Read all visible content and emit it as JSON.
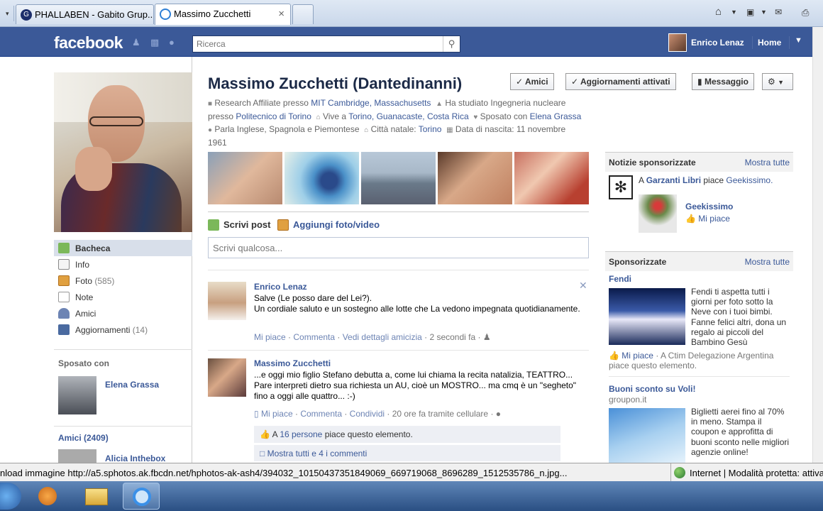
{
  "browser": {
    "tabs": [
      {
        "label": "PHALLABEN - Gabito Grup...",
        "icon": "g-favicon"
      },
      {
        "label": "Massimo Zucchetti",
        "icon": "ie-icon"
      }
    ],
    "close_glyph": "×"
  },
  "fb": {
    "logo": "facebook",
    "search_placeholder": "Ricerca",
    "user": "Enrico Lenaz",
    "home": "Home"
  },
  "profile": {
    "name": "Massimo Zucchetti (Dantedinanni)",
    "buttons": [
      "Amici",
      "Aggiornamenti attivati",
      "Messaggio"
    ],
    "info": {
      "research_pre": "Research Affiliate presso",
      "research_org": "MIT Cambridge, Massachusetts",
      "studied_pre": "Ha studiato Ingegneria nucleare presso",
      "studied_org": "Politecnico di Torino",
      "lives_pre": "Vive a",
      "lives_loc": "Torino, Guanacaste, Costa Rica",
      "married_pre": "Sposato con",
      "married_to": "Elena Grassa",
      "languages": "Parla Inglese, Spagnola e Piemontese",
      "hometown_pre": "Città natale:",
      "hometown": "Torino",
      "birth_pre": "Data di nascita:",
      "birth": "11 novembre 1961"
    }
  },
  "left_nav": {
    "items": [
      {
        "label": "Bacheca",
        "count": ""
      },
      {
        "label": "Info",
        "count": ""
      },
      {
        "label": "Foto",
        "count": "(585)"
      },
      {
        "label": "Note",
        "count": ""
      },
      {
        "label": "Amici",
        "count": ""
      },
      {
        "label": "Aggiornamenti",
        "count": "(14)"
      }
    ],
    "spouse_head": "Sposato con",
    "spouse": "Elena Grassa",
    "friends_head": "Amici (2409)",
    "friend": "Alicia Inthebox"
  },
  "composer": {
    "write_post": "Scrivi post",
    "add_photo": "Aggiungi foto/video",
    "placeholder": "Scrivi qualcosa..."
  },
  "posts": [
    {
      "author": "Enrico Lenaz",
      "text": "Salve (Le posso dare del Lei?).\nUn cordiale saluto e un sostegno alle lotte che La vedono impegnata quotidianamente.",
      "actions": [
        "Mi piace",
        "Commenta",
        "Vedi dettagli amicizia"
      ],
      "time": "2 secondi fa"
    },
    {
      "author": "Massimo Zucchetti",
      "text": "...e oggi mio figlio Stefano debutta a, come lui chiama la recita natalizia, TEATTRO... Pare interpreti dietro sua richiesta un AU, cioè un MOSTRO... ma cmq è un \"segheto\" fino a oggi alle quattro... :-)",
      "actions": [
        "Mi piace",
        "Commenta",
        "Condividi"
      ],
      "time": "20 ore fa tramite cellulare",
      "likes_pre": "A",
      "likes_link": "16 persone",
      "likes_post": "piace questo elemento.",
      "comments": "Mostra tutti e 4 i commenti"
    }
  ],
  "right_col": {
    "news_head": "Notizie sponsorizzate",
    "show_all": "Mostra tutte",
    "news_pre": "A",
    "news_actor": "Garzanti Libri",
    "news_verb": "piace",
    "news_obj": "Geekissimo.",
    "page_name": "Geekissimo",
    "page_like": "Mi piace",
    "sponsored_head": "Sponsorizzate",
    "ads": [
      {
        "title": "Fendi",
        "text": "Fendi ti aspetta tutti i giorni per foto sotto la Neve con i tuoi bimbi. Fanne felici altri, dona un regalo ai piccoli del Bambino Gesù",
        "like": "Mi piace",
        "like_social": "· A Ctim Delegazione Argentina piace questo elemento."
      },
      {
        "title": "Buoni sconto su Voli!",
        "domain": "groupon.it",
        "text": "Biglietti aerei fino al 70% in meno. Stampa il coupon e approfitta di buoni sconto nelle migliori agenzie online!"
      }
    ]
  },
  "statusbar": {
    "text": "nload immagine http://a5.sphotos.ak.fbcdn.net/hphotos-ak-ash4/394032_10150437351849069_669719068_8696289_1512535786_n.jpg...",
    "zone": "Internet | Modalità protetta: attiva"
  }
}
